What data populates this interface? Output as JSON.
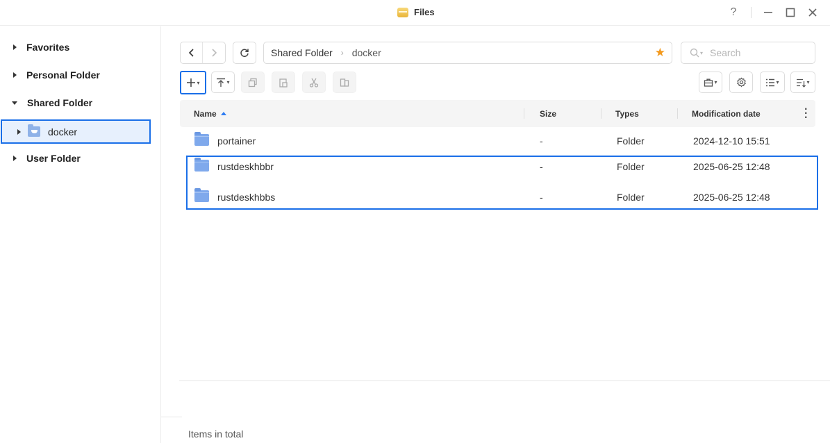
{
  "window": {
    "title": "Files",
    "controls": {
      "help": "?",
      "minimize": "—",
      "maximize": "☐",
      "close": "✕"
    }
  },
  "sidebar": {
    "items": [
      {
        "label": "Favorites",
        "expanded": false
      },
      {
        "label": "Personal Folder",
        "expanded": false
      },
      {
        "label": "Shared Folder",
        "expanded": true
      },
      {
        "label": "User Folder",
        "expanded": false
      }
    ],
    "sub_items": [
      {
        "label": "docker",
        "selected": true
      }
    ]
  },
  "toolbar": {
    "back": "‹",
    "forward": "›",
    "refresh": "⟳",
    "breadcrumb": [
      "Shared Folder",
      "docker"
    ],
    "breadcrumb_sep": "›",
    "search_placeholder": "Search",
    "favorite_color": "#f39a1e"
  },
  "table": {
    "columns": {
      "name": "Name",
      "size": "Size",
      "types": "Types",
      "modified": "Modification date"
    },
    "sort": {
      "column": "name",
      "direction": "ascending"
    },
    "rows": [
      {
        "name": "portainer",
        "size": "-",
        "type": "Folder",
        "modified": "2024-12-10 15:51"
      },
      {
        "name": "rustdeskhbbr",
        "size": "-",
        "type": "Folder",
        "modified": "2025-06-25 12:48"
      },
      {
        "name": "rustdeskhbbs",
        "size": "-",
        "type": "Folder",
        "modified": "2025-06-25 12:48"
      }
    ]
  },
  "footer": {
    "text": "Items in total"
  },
  "colors": {
    "accent": "#1a6fe8",
    "folder": "#7fa9ec",
    "selection_bg": "#e7f0fd"
  }
}
